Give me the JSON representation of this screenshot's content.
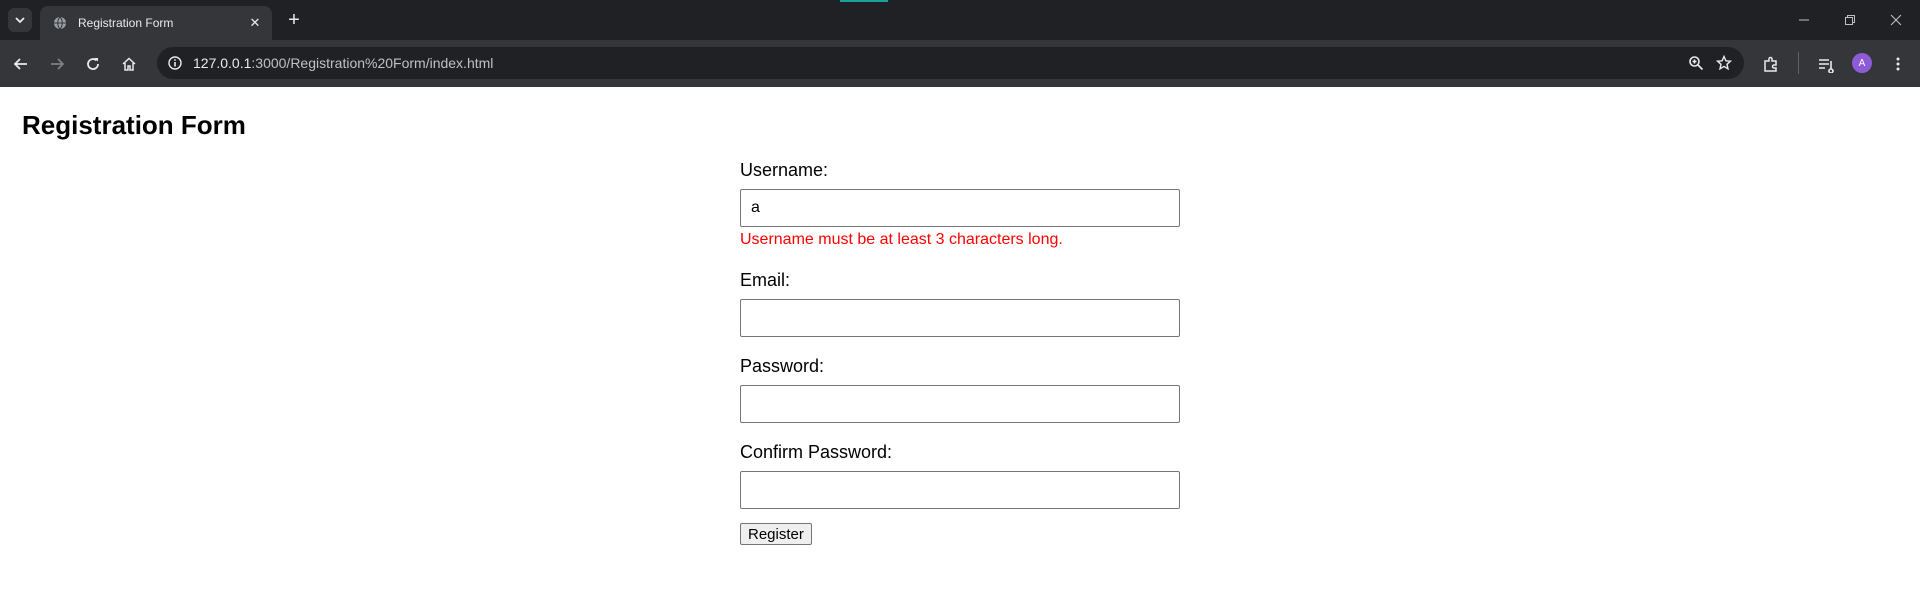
{
  "browser": {
    "tab_title": "Registration Form",
    "url_host": "127.0.0.1",
    "url_rest": ":3000/Registration%20Form/index.html",
    "profile_initial": "A",
    "new_tab_symbol": "+",
    "close_symbol": "✕",
    "icons": [
      "chevron-down-icon",
      "globe-icon",
      "close-icon",
      "plus-icon",
      "minimize-icon",
      "restore-icon",
      "window-close-icon",
      "back-icon",
      "forward-icon",
      "reload-icon",
      "home-icon",
      "site-info-icon",
      "zoom-icon",
      "star-icon",
      "extensions-icon",
      "reading-list-icon",
      "menu-icon"
    ]
  },
  "page": {
    "title": "Registration Form",
    "form": {
      "username_label": "Username:",
      "username_value": "a",
      "username_error": "Username must be at least 3 characters long.",
      "email_label": "Email:",
      "email_value": "",
      "password_label": "Password:",
      "password_value": "",
      "confirm_label": "Confirm Password:",
      "confirm_value": "",
      "register_label": "Register"
    }
  },
  "colors": {
    "error": "#ff0000",
    "chrome_dark": "#202124",
    "chrome_toolbar": "#35363a",
    "avatar": "#8e5bd6"
  }
}
